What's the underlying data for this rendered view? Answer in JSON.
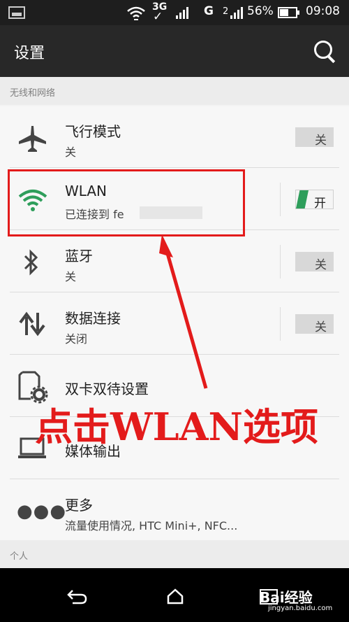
{
  "status_bar": {
    "network_3g": "3G",
    "network_g": "G",
    "network_2": "2",
    "battery": "56%",
    "time": "09:08"
  },
  "action_bar": {
    "title": "设置"
  },
  "sections": {
    "wireless": "无线和网络",
    "personal": "个人"
  },
  "items": [
    {
      "title": "飞行模式",
      "subtitle": "关",
      "toggle": "关"
    },
    {
      "title": "WLAN",
      "subtitle": "已连接到 fe",
      "toggle": "开"
    },
    {
      "title": "蓝牙",
      "subtitle": "关",
      "toggle": "关"
    },
    {
      "title": "数据连接",
      "subtitle": "关闭",
      "toggle": "关"
    },
    {
      "title": "双卡双待设置"
    },
    {
      "title": "媒体输出"
    },
    {
      "title": "更多",
      "subtitle": "流量使用情况, HTC Mini+, NFC..."
    }
  ],
  "annotation": "点击WLAN选项",
  "watermark": {
    "logo": "Bai经验",
    "url": "jingyan.baidu.com"
  },
  "colors": {
    "accent_green": "#2e9e5b",
    "annotation_red": "#e31b1b"
  },
  "icons": [
    "image-icon",
    "wifi-status-icon",
    "signal-icon",
    "battery-icon",
    "search-icon",
    "airplane-icon",
    "wifi-icon",
    "bluetooth-icon",
    "data-transfer-icon",
    "sim-settings-icon",
    "cast-icon",
    "more-icon",
    "back-icon",
    "home-icon",
    "recent-apps-icon"
  ]
}
